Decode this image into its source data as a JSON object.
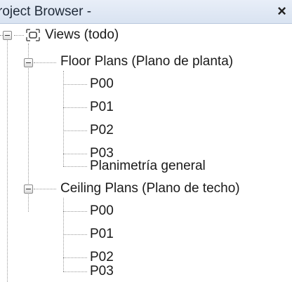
{
  "panel": {
    "title": "roject Browser -",
    "close_glyph": "×"
  },
  "tree": {
    "root": {
      "label": "Views (todo)",
      "icon": "views-icon",
      "groups": [
        {
          "label": "Floor Plans (Plano de planta)",
          "items": [
            "P00",
            "P01",
            "P02",
            "P03",
            "Planimetría general"
          ]
        },
        {
          "label": "Ceiling Plans (Plano de techo)",
          "items": [
            "P00",
            "P01",
            "P02",
            "P03"
          ]
        }
      ]
    }
  }
}
